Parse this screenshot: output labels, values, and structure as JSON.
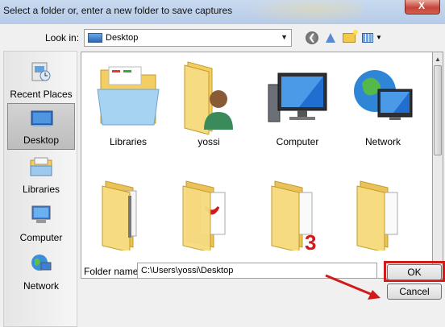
{
  "window": {
    "title": "Select a folder or, enter a new folder to save captures",
    "close_label": "X"
  },
  "toolbar": {
    "lookin_label": "Look in:",
    "lookin_value": "Desktop"
  },
  "places": [
    {
      "label": "Recent Places",
      "icon": "recent-places-icon",
      "selected": false
    },
    {
      "label": "Desktop",
      "icon": "desktop-icon",
      "selected": true
    },
    {
      "label": "Libraries",
      "icon": "libraries-icon",
      "selected": false
    },
    {
      "label": "Computer",
      "icon": "computer-icon",
      "selected": false
    },
    {
      "label": "Network",
      "icon": "network-icon",
      "selected": false
    }
  ],
  "items": [
    {
      "label": "Libraries",
      "icon": "libraries-folder-icon"
    },
    {
      "label": "yossi",
      "icon": "user-folder-icon"
    },
    {
      "label": "Computer",
      "icon": "computer-icon"
    },
    {
      "label": "Network",
      "icon": "network-globe-icon"
    },
    {
      "label": "",
      "icon": "folder-icon"
    },
    {
      "label": "",
      "icon": "pdf-folder-icon"
    },
    {
      "label": "",
      "icon": "folder-icon"
    },
    {
      "label": "",
      "icon": "folder-icon"
    }
  ],
  "form": {
    "folder_name_label": "Folder name:",
    "folder_name_value": "C:\\Users\\yossi\\Desktop"
  },
  "buttons": {
    "ok": "OK",
    "cancel": "Cancel"
  },
  "annotation": {
    "step": "3",
    "color": "#d21a1a"
  }
}
